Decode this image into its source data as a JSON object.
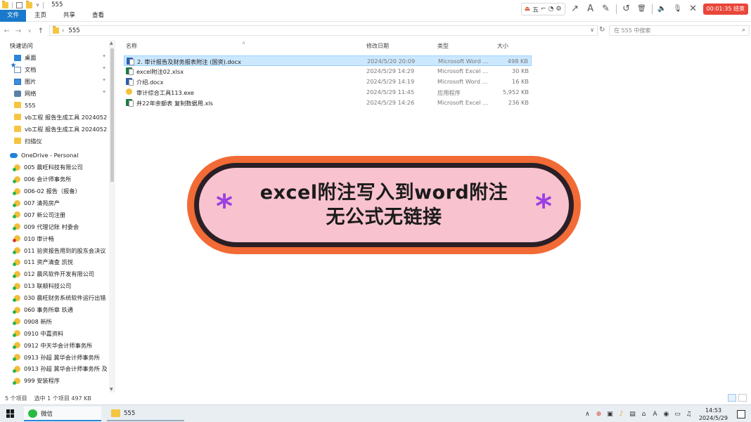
{
  "window": {
    "title": "555",
    "quick_access_caret": "∨"
  },
  "recorder": {
    "group1": [
      "⏏",
      "五",
      "⌐",
      "◔",
      "⚙"
    ],
    "tools": [
      "↗",
      "A",
      "✎"
    ],
    "undo_icon": "↺",
    "trash_icon": "🗑",
    "speaker_icon": "🔈",
    "mic_icon": "🎙",
    "close_icon": "✕",
    "timer": "00:01:35 结束"
  },
  "ribbon": {
    "tabs": [
      "文件",
      "主页",
      "共享",
      "查看"
    ]
  },
  "address": {
    "back": "←",
    "forward": "→",
    "recent": "∨",
    "up": "↑",
    "sep": "›",
    "path": "555",
    "dropdown": "∨",
    "refresh": "↻",
    "search_placeholder": "在 555 中搜索",
    "search_icon": "⌕"
  },
  "sidebar": {
    "quick_access": "快速访问",
    "pinned": [
      {
        "label": "桌面",
        "icon": "desktop"
      },
      {
        "label": "文档",
        "icon": "doc"
      },
      {
        "label": "图片",
        "icon": "pic"
      },
      {
        "label": "网络",
        "icon": "net"
      }
    ],
    "pin_glyph": "📌",
    "folders": [
      "555",
      "vb工程 报告生成工具 2024052",
      "vb工程 报告生成工具 2024052",
      "扫描仪"
    ],
    "onedrive": "OneDrive - Personal",
    "onedrive_items": [
      "005 晨旺科技有限公司",
      "006 会计师事务所",
      "006-02 报告（报备）",
      "007 清苑房产",
      "007 新公司注册",
      "009 代理记账 村委会",
      "010 审计畅",
      "011 验资报告用到的股东会决议",
      "011 资产清查 凯悦",
      "012 晨风软件开发有限公司",
      "013 联顺科技公司",
      "030 晨旺财务系统软件运行出错",
      "060 事务所章 玖通",
      "0908 新所",
      "0910 中嘉资料",
      "0912 中天华会计师事务所",
      "0913 孙超 冀华会计师事务所",
      "0913 孙超 冀华会计师事务所 及",
      "999 安装程序"
    ],
    "scroll_up": "▲",
    "scroll_down": "▼"
  },
  "filelist": {
    "columns": {
      "name": "名称",
      "modified": "修改日期",
      "type": "类型",
      "size": "大小"
    },
    "sort_caret": "∧",
    "files": [
      {
        "name": "2. 审计报告及财务报表附注 (国资).docx",
        "modified": "2024/5/20 20:09",
        "type": "Microsoft Word ...",
        "size": "498 KB",
        "kind": "word",
        "selected": true
      },
      {
        "name": "excel附注02.xlsx",
        "modified": "2024/5/29 14:29",
        "type": "Microsoft Excel ...",
        "size": "30 KB",
        "kind": "excel",
        "selected": false
      },
      {
        "name": "介绍.docx",
        "modified": "2024/5/29 14:19",
        "type": "Microsoft Word ...",
        "size": "16 KB",
        "kind": "word",
        "selected": false
      },
      {
        "name": "审计综合工具113.exe",
        "modified": "2024/5/29 11:45",
        "type": "应用程序",
        "size": "5,952 KB",
        "kind": "exe",
        "selected": false
      },
      {
        "name": "并22年余额表 复制数据用.xls",
        "modified": "2024/5/29 14:26",
        "type": "Microsoft Excel ...",
        "size": "236 KB",
        "kind": "xls",
        "selected": false
      }
    ]
  },
  "banner": {
    "line1": "excel附注写入到word附注",
    "line2": "无公式无链接",
    "star": "*"
  },
  "status": {
    "count": "5 个项目",
    "selection": "选中 1 个项目  497 KB"
  },
  "taskbar": {
    "apps": [
      {
        "label": "微信"
      },
      {
        "label": "555"
      }
    ],
    "tray_icons": [
      "∧",
      "⊕",
      "▣",
      "♪",
      "▤",
      "⌂",
      "A",
      "◉",
      "▭",
      "♫"
    ],
    "time": "14:53",
    "date": "2024/5/29"
  },
  "colors": {
    "accent": "#1979ca",
    "selection": "#cce8ff",
    "banner_outer": "#f26a35",
    "banner_fill": "#f8c2cf",
    "banner_star": "#9b3fe0",
    "timer": "#e8473a"
  }
}
